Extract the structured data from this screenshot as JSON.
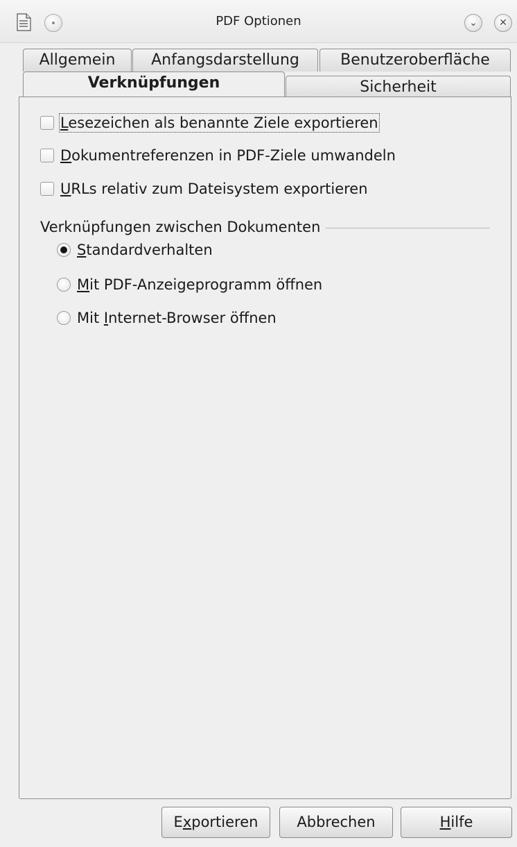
{
  "window": {
    "title": "PDF Optionen",
    "icons": {
      "app": "document-icon",
      "menu": "window-menu-icon",
      "minimize": "minimize-icon",
      "close": "close-icon"
    }
  },
  "tabs": {
    "allgemein": "Allgemein",
    "anfangsdarstellung": "Anfangsdarstellung",
    "benutzeroberflaeche": "Benutzeroberfläche",
    "verknuepfungen": "Verknüpfungen",
    "sicherheit": "Sicherheit",
    "active": "Verknüpfungen"
  },
  "options": {
    "bookmarks": {
      "first": "L",
      "rest": "esezeichen als benannte Ziele exportieren",
      "checked": false
    },
    "docrefs": {
      "first": "D",
      "rest": "okumentreferenzen in PDF-Ziele umwandeln",
      "checked": false
    },
    "urls": {
      "first": "U",
      "rest": "RLs relativ zum Dateisystem exportieren",
      "checked": false
    }
  },
  "crossdoc": {
    "group_label": "Verknüpfungen zwischen Dokumenten",
    "standard": {
      "first": "S",
      "rest": "tandardverhalten",
      "checked": true
    },
    "pdf_viewer": {
      "first": "M",
      "rest": "it PDF-Anzeigeprogramm öffnen",
      "checked": false
    },
    "browser": {
      "pre": "Mit ",
      "mnemonic": "I",
      "rest": "nternet-Browser öffnen",
      "checked": false
    }
  },
  "buttons": {
    "export": {
      "pre": "E",
      "mnemonic": "x",
      "rest": "portieren"
    },
    "cancel": "Abbrechen",
    "help": {
      "mnemonic": "H",
      "rest": "ilfe"
    }
  },
  "colors": {
    "background": "#efefef",
    "border": "#8f8f8f"
  }
}
